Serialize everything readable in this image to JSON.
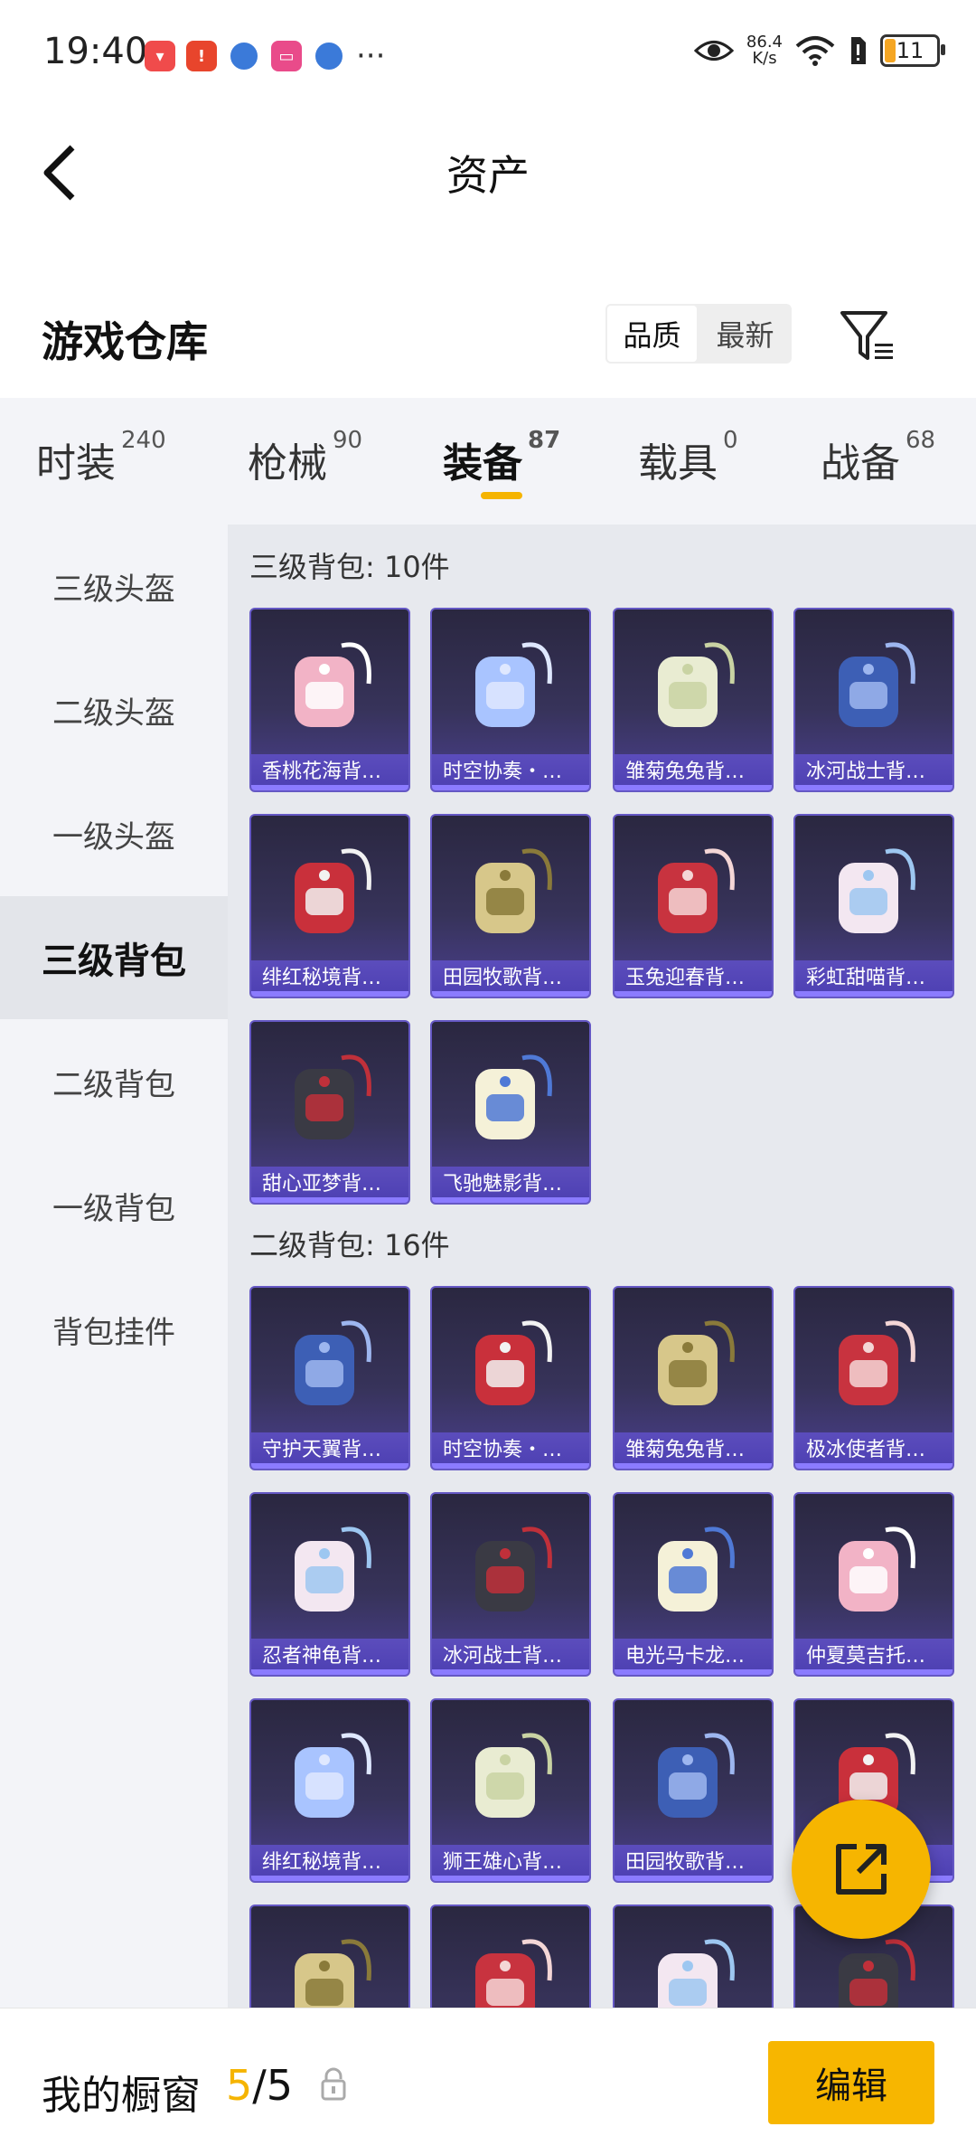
{
  "status_bar": {
    "time": "19:40",
    "speed_value": "86.4",
    "speed_unit": "K/s",
    "battery": "11",
    "more": "···",
    "notification_icons": [
      "shopping-bag-icon",
      "alert-app-icon",
      "browser-icon",
      "video-app-icon",
      "browser-icon"
    ]
  },
  "nav": {
    "title": "资产"
  },
  "header": {
    "title": "游戏仓库",
    "sort_options": [
      "品质",
      "最新"
    ],
    "sort_active": "品质"
  },
  "category_tabs": [
    {
      "label": "时装",
      "count": "240"
    },
    {
      "label": "枪械",
      "count": "90"
    },
    {
      "label": "装备",
      "count": "87"
    },
    {
      "label": "载具",
      "count": "0"
    },
    {
      "label": "战备",
      "count": "68"
    }
  ],
  "side_menu": [
    "三级头盔",
    "二级头盔",
    "一级头盔",
    "三级背包",
    "二级背包",
    "一级背包",
    "背包挂件"
  ],
  "side_menu_active": "三级背包",
  "groups": [
    {
      "title": "三级背包: 10件",
      "items": [
        "香桃花海背…",
        "时空协奏・…",
        "雏菊兔兔背…",
        "冰河战士背…",
        "绯红秘境背…",
        "田园牧歌背…",
        "玉兔迎春背…",
        "彩虹甜喵背…",
        "甜心亚梦背…",
        "飞驰魅影背…"
      ]
    },
    {
      "title": "二级背包: 16件",
      "items": [
        "守护天翼背…",
        "时空协奏・…",
        "雏菊兔兔背…",
        "极冰使者背…",
        "忍者神龟背…",
        "冰河战士背…",
        "电光马卡龙…",
        "仲夏莫吉托…",
        "绯红秘境背…",
        "狮王雄心背…",
        "田园牧歌背…",
        "",
        "",
        "",
        "",
        ""
      ]
    }
  ],
  "bottom_bar": {
    "title": "我的橱窗",
    "current": "5",
    "separator": "/",
    "total": "5",
    "edit_label": "编辑"
  },
  "colors": {
    "accent": "#f5b400",
    "card_border": "#6558c4",
    "card_label": "#4c3fb1"
  }
}
